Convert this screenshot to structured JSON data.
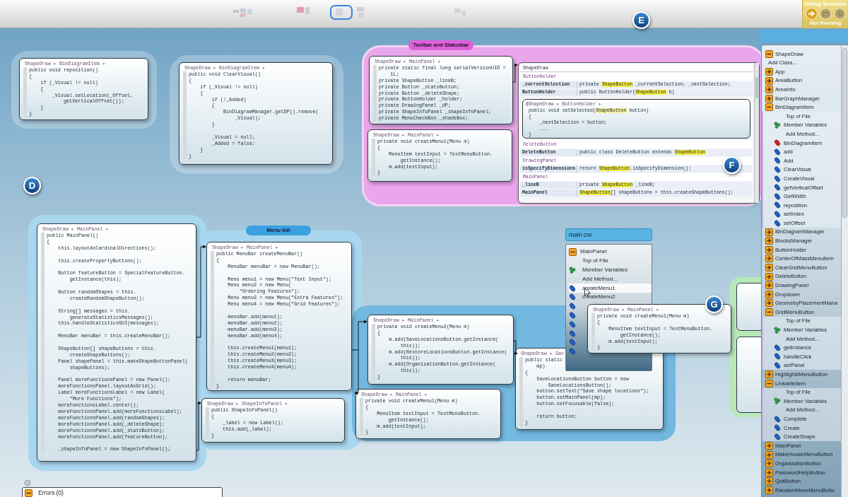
{
  "debug_sessions": {
    "title": "Debug Sessions",
    "status": "Not Running",
    "buttons": [
      {
        "kind": "continue",
        "disabled": false
      },
      {
        "kind": "step",
        "disabled": true
      },
      {
        "kind": "stop",
        "disabled": true
      }
    ]
  },
  "markers": [
    {
      "label": "E"
    },
    {
      "label": "D"
    },
    {
      "label": "F"
    },
    {
      "label": "G"
    }
  ],
  "groups": [
    {
      "label": "Toolbar and Statusbar",
      "color": "#e060d8"
    },
    {
      "label": "Menu Init",
      "color": "#3aa0e0"
    }
  ],
  "bubbles": [
    {
      "breadcrumb": "ShapeDraw ▸ BinDiagramItem ▸",
      "blocks": [
        [
          "public void reposition()",
          "{",
          "    if (_Visual != null)",
          "    {",
          "        _Visual.setLocation(_Offset,",
          "            getVerticalOffset());",
          "    }",
          "}"
        ]
      ]
    },
    {
      "breadcrumb": "ShapeDraw ▸ BinDiagramItem ▸",
      "blocks": [
        [
          "public void ClearVisual()",
          "{",
          "    if (_Visual != null)",
          "    {",
          "        if (!_Added)",
          "        {",
          "            BinDiagramManager.getDP().remove(",
          "                _Visual);",
          "        }"
        ],
        [
          "        _Visual = null;",
          "        _Added = false;",
          "    }",
          "}"
        ]
      ]
    },
    {
      "breadcrumb": "ShapeDraw ▸ MainPanel ▸",
      "blocks": [
        [
          "private static final long serialVersionUID =",
          "    1L;",
          "private ShapeButton _lineB;",
          "private Button _statsButton;",
          "private Button _deleteShape;",
          "private ButtonHolder _holder;",
          "private DrawingPanel _dP;",
          "private ShapeInfoPanel _shapeInfoPanel;",
          "private MenuCheckBox _shadeBox;"
        ]
      ]
    },
    {
      "breadcrumb": "ShapeDraw ▸ MainPanel ▸",
      "blocks": [
        [
          "private void createMenu1(Menu m)",
          "{",
          "    MenuItem textInput = TextMenuButton.",
          "        getInstance();",
          "    m.add(textInput);",
          "}"
        ]
      ]
    },
    {
      "breadcrumb": "ShapeDraw ▸ MainPanel ▸",
      "blocks": [
        [
          "public MainPanel()",
          "{",
          "    this.layoutAsCardinalDirections();"
        ],
        [
          "    this.createPropertyButtons();"
        ],
        [
          "    Button featureButton = SpecialFeatureButton.",
          "        getInstance(this);"
        ],
        [
          "    Button randomShapes = this.",
          "        createRandomShapeButton();"
        ],
        [
          "    String[] messages = this.",
          "        generateStatisticsMessages();",
          "    this.handleStatisticsGUI(messages);"
        ],
        [
          "    MenuBar menuBar = this.createMenuBar();"
        ],
        [
          "    ShapeButton[] shapeButtons = this.",
          "        createShapeButtons();",
          "    Panel shapePanel = this.makeShapeButtonPanel(",
          "        shapeButtons);"
        ],
        [
          "    Panel moreFunctionsPanel = new Panel();",
          "    moreFunctionsPanel.layoutAsGrid();",
          "    Label moreFunctionsLabel = new Label(",
          "        \"More Functions\");",
          "    moreFunctionsLabel.center();",
          "    moreFunctionsPanel.add(moreFunctionsLabel);",
          "    moreFunctionsPanel.add(randomShapes);",
          "    moreFunctionsPanel.add(_deleteShape);",
          "    moreFunctionsPanel.add(_statsButton);",
          "    moreFunctionsPanel.add(featureButton);"
        ],
        [
          "    _shapeInfoPanel = new ShapeInfoPanel();"
        ]
      ]
    },
    {
      "breadcrumb": "ShapeDraw ▸ MainPanel ▸",
      "blocks": [
        [
          "public MenuBar createMenuBar()",
          "{",
          "    MenuBar menuBar = new MenuBar();"
        ],
        [
          "    Menu menu1 = new Menu(\"Text Input\");",
          "    Menu menu2 = new Menu(",
          "        \"Ordering Features\");",
          "    Menu menu3 = new Menu(\"Extra Features\");",
          "    Menu menu4 = new Menu(\"Grid Features\");"
        ],
        [
          "    menuBar.add(menu1);",
          "    menuBar.add(menu2);",
          "    menuBar.add(menu3);",
          "    menuBar.add(menu4);"
        ],
        [
          "    this.createMenu1(menu1);",
          "    this.createMenu2(menu2);",
          "    this.createMenu3(menu3);",
          "    this.createMenu4(menu4);"
        ],
        [
          "    return menuBar;",
          "}"
        ]
      ]
    },
    {
      "breadcrumb": "ShapeDraw ▸ ShapeInfoPanel ▸",
      "blocks": [
        [
          "public ShapeInfoPanel()",
          "{",
          "    _label = new Label();",
          "    this.add(_label);",
          "}"
        ]
      ]
    },
    {
      "breadcrumb": "ShapeDraw ▸ MainPanel ▸",
      "blocks": [
        [
          "private void createMenu2(Menu m)",
          "{",
          "    m.add(SaveLocationsButton.getInstance(",
          "        this));",
          "    m.add(RestoreLocationsButton.getInstance(",
          "        this));",
          "    m.add(OrganizationButton.getInstance(",
          "        this));",
          "}"
        ]
      ]
    },
    {
      "breadcrumb": "ShapeDraw ▸ MainPanel ▸",
      "blocks": [
        [
          "private void createMenu1(Menu m)",
          "{",
          "    MenuItem textInput = TextMenuButton.",
          "        getInstance();",
          "    m.add(textInput);",
          "}"
        ]
      ]
    },
    {
      "breadcrumb": "ShapeDraw ▸ Sav",
      "blocks": [
        [
          "public static",
          "    mp)",
          "{",
          "    SaveLocationsButton button = new",
          "        SaveLocationsButton();",
          "    button.setText(\"Save shape locations\");",
          "    button.setMainPanel(mp);",
          "    button.setFocusable(false);"
        ],
        [
          "    return button;",
          "}"
        ]
      ]
    },
    {
      "breadcrumb": "ShapeDraw ▸ MainPanel ▸",
      "blocks": [
        [
          "private void createMenu1(Menu m)",
          "{",
          "    MenuItem textInput = TextMenuButton.",
          "        getInstance();",
          "    m.add(textInput);",
          "}"
        ]
      ]
    }
  ],
  "class_search": {
    "title": "ShapeDraw",
    "groups": [
      {
        "name": "ButtonHolder",
        "rows": [
          {
            "member": "_currentSelection",
            "code": "private **ShapeButton** _currentSelection, _nextSelection;"
          },
          {
            "member": "ButtonHolder",
            "code": "public ButtonHolder(**ShapeButton** b)"
          }
        ],
        "preview": {
          "breadcrumb": "@ShapeDraw ▸ ButtonHolder ▸",
          "lines": [
            "public void setSelected(**ShapeButton** button)",
            "{",
            "    _nextSelection = button;",
            "    ...",
            "}"
          ]
        }
      },
      {
        "name": "DeleteButton",
        "rows": [
          {
            "member": "DeleteButton",
            "code": "public class DeleteButton extends **ShapeButton**"
          }
        ]
      },
      {
        "name": "DrawingPanel",
        "rows": [
          {
            "member": "isSpecifyDimensions",
            "code": "return **ShapeButton**.isSpecifyDimension();"
          }
        ]
      },
      {
        "name": "MainPanel",
        "rows": [
          {
            "member": "_lineB",
            "code": "private **ShapeButton** _lineB;"
          },
          {
            "member": "MainPanel",
            "code": "**ShapeButton**[] shapeButtons = this.createShapeButtons();"
          }
        ]
      }
    ]
  },
  "search": {
    "value": "main cre",
    "results": [
      {
        "label": "MainPanel",
        "kind": "class",
        "selected": false
      },
      {
        "label": "Top of File",
        "kind": "section",
        "selected": false
      },
      {
        "label": "Member Variables",
        "kind": "variables",
        "selected": false
      },
      {
        "label": "Add Method...",
        "kind": "action",
        "selected": false
      },
      {
        "label": "createMenu1",
        "kind": "method",
        "selected": true
      },
      {
        "label": "createMenu2",
        "kind": "method",
        "selected": false
      },
      {
        "kind": "method",
        "selected": false
      },
      {
        "kind": "method",
        "selected": false
      },
      {
        "kind": "method",
        "selected": false
      },
      {
        "kind": "method",
        "selected": false
      },
      {
        "kind": "method",
        "selected": false
      },
      {
        "kind": "method",
        "selected": false
      }
    ]
  },
  "package_explorer": {
    "items": [
      {
        "label": "ShapeDraw",
        "kind": "class",
        "expanded": true,
        "children": [
          {
            "label": "Add Class...",
            "kind": "action"
          },
          {
            "label": "App",
            "kind": "class",
            "expanded": false
          },
          {
            "label": "AreaButton",
            "kind": "class",
            "expanded": false
          },
          {
            "label": "AreaInfo",
            "kind": "class",
            "expanded": false
          },
          {
            "label": "BarGraphManager",
            "kind": "class",
            "expanded": false
          },
          {
            "label": "BinDiagramItem",
            "kind": "class",
            "expanded": true,
            "children": [
              {
                "label": "Top of File",
                "kind": "section"
              },
              {
                "label": "Member Variables",
                "kind": "variables"
              },
              {
                "label": "Add Method...",
                "kind": "action"
              },
              {
                "label": "BinDiagramItem",
                "kind": "constructor"
              },
              {
                "label": "add",
                "kind": "method"
              },
              {
                "label": "Add",
                "kind": "method"
              },
              {
                "label": "ClearVisual",
                "kind": "method"
              },
              {
                "label": "CreateVisual",
                "kind": "method"
              },
              {
                "label": "getVerticalOffset",
                "kind": "method"
              },
              {
                "label": "GetWidth",
                "kind": "method"
              },
              {
                "label": "reposition",
                "kind": "method"
              },
              {
                "label": "setIndex",
                "kind": "method"
              },
              {
                "label": "setOffset",
                "kind": "method"
              }
            ]
          },
          {
            "label": "BinDiagramManager",
            "kind": "class",
            "expanded": false
          },
          {
            "label": "BlocksManager",
            "kind": "class",
            "expanded": false
          },
          {
            "label": "ButtonHolder",
            "kind": "class",
            "expanded": false
          },
          {
            "label": "CenterOfMassMenuItem",
            "kind": "class",
            "expanded": false
          },
          {
            "label": "ClearGridMenuButton",
            "kind": "class",
            "expanded": false
          },
          {
            "label": "DeleteButton",
            "kind": "class",
            "expanded": false
          },
          {
            "label": "DrawingPanel",
            "kind": "class",
            "expanded": false
          },
          {
            "label": "Dropdown",
            "kind": "class",
            "expanded": false
          },
          {
            "label": "GeometryPlacementMana",
            "kind": "class",
            "expanded": false
          },
          {
            "label": "GridMenuButton",
            "kind": "class",
            "expanded": true,
            "children": [
              {
                "label": "Top of File",
                "kind": "section"
              },
              {
                "label": "Member Variables",
                "kind": "variables"
              },
              {
                "label": "Add Method...",
                "kind": "action"
              },
              {
                "label": "getInstance",
                "kind": "method"
              },
              {
                "label": "handleClick",
                "kind": "method"
              },
              {
                "label": "setPanel",
                "kind": "method"
              }
            ]
          },
          {
            "label": "HighlightsMenuButton",
            "kind": "class",
            "expanded": false
          },
          {
            "label": "LinkableItem",
            "kind": "class",
            "expanded": true,
            "children": [
              {
                "label": "Top of File",
                "kind": "section"
              },
              {
                "label": "Member Variables",
                "kind": "variables"
              },
              {
                "label": "Add Method...",
                "kind": "action"
              },
              {
                "label": "Complete",
                "kind": "method"
              },
              {
                "label": "Create",
                "kind": "method"
              },
              {
                "label": "CreateShape",
                "kind": "method"
              }
            ]
          },
          {
            "label": "MainPanel",
            "kind": "class",
            "expanded": false
          },
          {
            "label": "MakeHouseMenuButton",
            "kind": "class",
            "expanded": false
          },
          {
            "label": "OrganizationButton",
            "kind": "class",
            "expanded": false
          },
          {
            "label": "PasswordHelpButton",
            "kind": "class",
            "expanded": false
          },
          {
            "label": "QuitButton",
            "kind": "class",
            "expanded": false
          },
          {
            "label": "RandomMoveMenuButto",
            "kind": "class",
            "expanded": false
          }
        ]
      }
    ]
  },
  "errors_panel": {
    "label": "Errors (0)"
  }
}
